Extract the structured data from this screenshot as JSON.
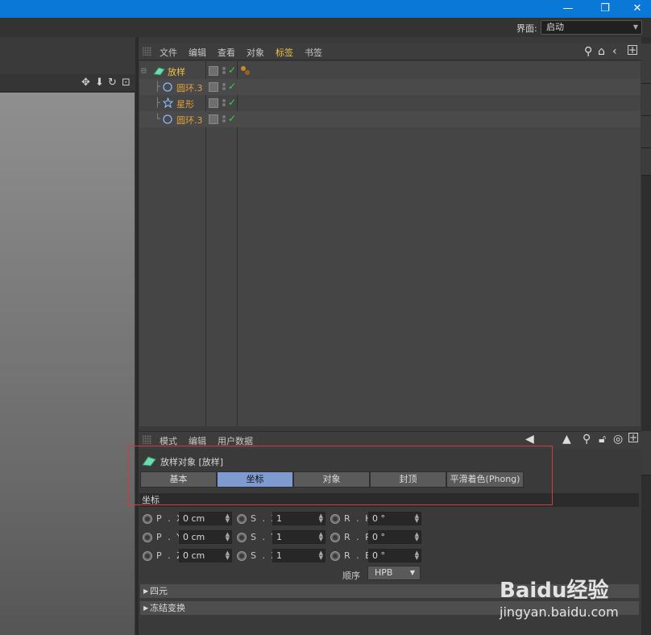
{
  "window": {
    "minimize": "—",
    "restore": "❐",
    "close": "✕"
  },
  "layout": {
    "label": "界面:",
    "value": "启动"
  },
  "object_manager": {
    "menu": [
      "文件",
      "编辑",
      "查看",
      "对象",
      "标签",
      "书签"
    ],
    "active_menu_index": 4,
    "tree": [
      {
        "name": "放样",
        "prefix": "⊟",
        "icon": "loft-icon",
        "level": 0
      },
      {
        "name": "圆环.3",
        "prefix": "├",
        "icon": "circle-spline-icon",
        "level": 1
      },
      {
        "name": "星形",
        "prefix": "├",
        "icon": "star-spline-icon",
        "level": 1
      },
      {
        "name": "圆环.3",
        "prefix": "└",
        "icon": "circle-spline-icon",
        "level": 1
      }
    ]
  },
  "attribute_manager": {
    "menu": [
      "模式",
      "编辑",
      "用户数据"
    ],
    "title": "放样对象 [放样]",
    "tabs": [
      "基本",
      "坐标",
      "对象",
      "封顶",
      "平滑着色(Phong)"
    ],
    "active_tab_index": 1,
    "section": "坐标",
    "fields": {
      "px": {
        "label": "P . X",
        "value": "0 cm"
      },
      "py": {
        "label": "P . Y",
        "value": "0 cm"
      },
      "pz": {
        "label": "P . Z",
        "value": "0 cm"
      },
      "sx": {
        "label": "S . X",
        "value": "1"
      },
      "sy": {
        "label": "S . Y",
        "value": "1"
      },
      "sz": {
        "label": "S . Z",
        "value": "1"
      },
      "rh": {
        "label": "R . H",
        "value": "0 °"
      },
      "rp": {
        "label": "R . P",
        "value": "0 °"
      },
      "rb": {
        "label": "R . B",
        "value": "0 °"
      }
    },
    "order": {
      "label": "顺序",
      "value": "HPB"
    },
    "collapsibles": [
      "四元",
      "冻结变换"
    ]
  },
  "watermark": {
    "logo": "Baidu经验",
    "url": "jingyan.baidu.com"
  },
  "colors": {
    "titlebar": "#0a78d7",
    "active_menu": "#f0c24b",
    "object_label": "#e2a03c",
    "active_tab": "#7d9bd0",
    "check": "#34d15a",
    "highlight": "#d3393d"
  }
}
